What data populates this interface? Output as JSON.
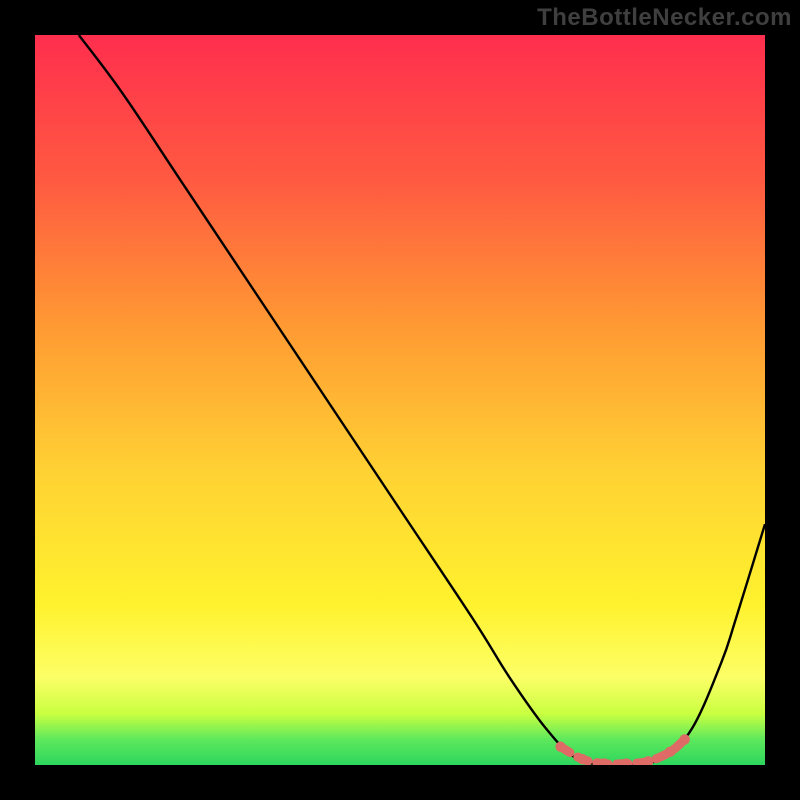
{
  "watermark": "TheBottleNecker.com",
  "chart_data": {
    "type": "line",
    "title": "",
    "xlabel": "",
    "ylabel": "",
    "xlim": [
      0,
      100
    ],
    "ylim": [
      0,
      100
    ],
    "series": [
      {
        "name": "curve",
        "color": "#000000",
        "x": [
          6,
          12,
          20,
          30,
          40,
          50,
          60,
          65,
          70,
          74,
          78,
          82,
          86,
          90,
          94,
          96,
          100
        ],
        "y": [
          100,
          92,
          80,
          65,
          50,
          35,
          20,
          12,
          5,
          1,
          0,
          0,
          1,
          5,
          14,
          20,
          33
        ]
      }
    ],
    "highlight": {
      "name": "highlight-segment",
      "color": "#de6b66",
      "points": [
        {
          "x": 72,
          "y": 2.5
        },
        {
          "x": 75,
          "y": 0.8
        },
        {
          "x": 78,
          "y": 0.2
        },
        {
          "x": 81,
          "y": 0.2
        },
        {
          "x": 84,
          "y": 0.5
        },
        {
          "x": 87,
          "y": 1.8
        },
        {
          "x": 89,
          "y": 3.5
        }
      ]
    },
    "gradient_stops": [
      {
        "offset": 0.0,
        "color": "#ff2e4e"
      },
      {
        "offset": 0.2,
        "color": "#ff5a41"
      },
      {
        "offset": 0.4,
        "color": "#ff9a33"
      },
      {
        "offset": 0.6,
        "color": "#ffd233"
      },
      {
        "offset": 0.78,
        "color": "#fff22e"
      },
      {
        "offset": 0.88,
        "color": "#fcff66"
      },
      {
        "offset": 0.93,
        "color": "#c9ff41"
      },
      {
        "offset": 0.965,
        "color": "#5ee85c"
      },
      {
        "offset": 1.0,
        "color": "#2dd65e"
      }
    ]
  }
}
